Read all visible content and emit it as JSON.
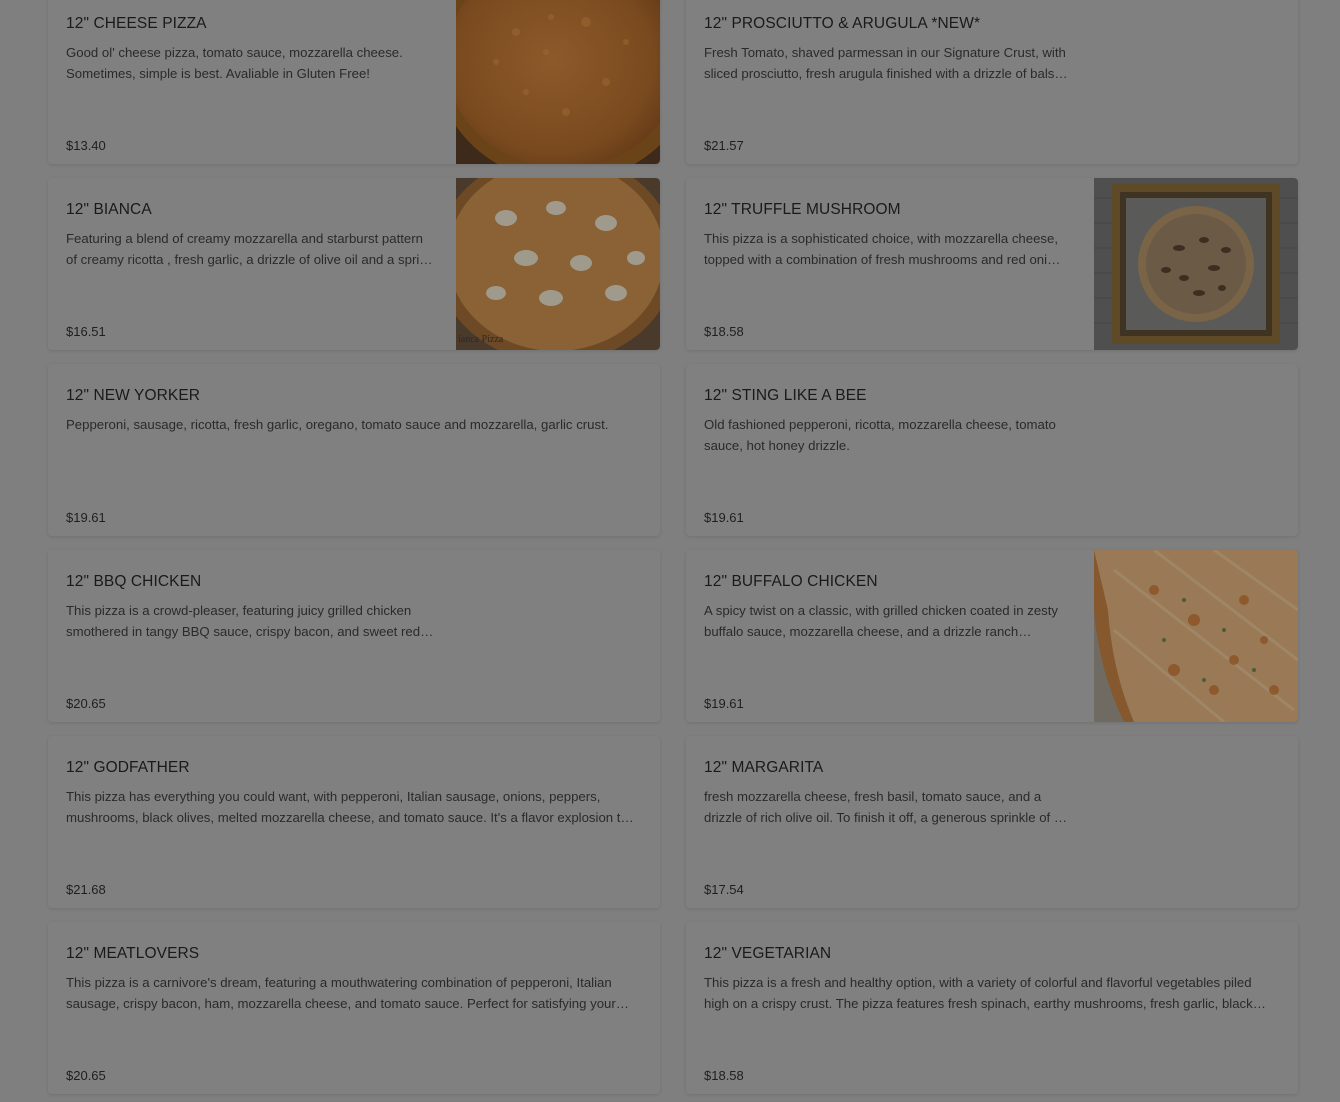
{
  "menu_items": [
    {
      "title": "12\" CHEESE PIZZA",
      "description": "Good ol' cheese pizza, tomato sauce, mozzarella cheese. Sometimes, simple is best. Avaliable in Gluten Free!",
      "price": "$13.40",
      "image": "cheese-pizza-photo"
    },
    {
      "title": "12\" PROSCIUTTO & ARUGULA *NEW*",
      "description": "Fresh Tomato, shaved parmessan in our Signature Crust, with sliced prosciutto, fresh arugula finished with a drizzle of bals…",
      "price": "$21.57",
      "image": ""
    },
    {
      "title": "12\" BIANCA",
      "description": "Featuring a blend of creamy mozzarella and starburst pattern of creamy ricotta , fresh garlic, a drizzle of olive oil and a spri…",
      "price": "$16.51",
      "image": "bianca-pizza-photo",
      "image_caption": "ianca Pizza"
    },
    {
      "title": "12\" TRUFFLE MUSHROOM",
      "description": "This pizza is a sophisticated choice, with mozzarella cheese, topped with a combination of fresh mushrooms and red oni…",
      "price": "$18.58",
      "image": "truffle-mushroom-pizza-photo"
    },
    {
      "title": "12\" NEW YORKER",
      "description": "Pepperoni, sausage, ricotta, fresh garlic, oregano, tomato sauce and mozzarella, garlic crust.",
      "price": "$19.61",
      "image": ""
    },
    {
      "title": "12\" STING LIKE A BEE",
      "description": "Old fashioned pepperoni, ricotta, mozzarella cheese, tomato sauce, hot honey drizzle.",
      "price": "$19.61",
      "image": ""
    },
    {
      "title": "12\" BBQ CHICKEN",
      "description": "This pizza is a crowd-pleaser, featuring juicy grilled chicken smothered in tangy BBQ sauce, crispy bacon, and sweet red …",
      "price": "$20.65",
      "image": ""
    },
    {
      "title": "12\" BUFFALO CHICKEN",
      "description": "A spicy twist on a classic, with grilled chicken coated in zesty buffalo sauce, mozzarella cheese, and a drizzle ranch dressing.",
      "price": "$19.61",
      "image": "buffalo-chicken-pizza-photo"
    },
    {
      "title": "12\" GODFATHER",
      "description": "This pizza has everything you could want, with pepperoni, Italian sausage, onions, peppers, mushrooms, black olives, melted mozzarella cheese, and tomato sauce. It's a flavor explosion t…",
      "price": "$21.68",
      "image": ""
    },
    {
      "title": "12\" MARGARITA",
      "description": "fresh mozzarella cheese, fresh basil, tomato sauce, and a drizzle of rich olive oil. To finish it off, a generous sprinkle of …",
      "price": "$17.54",
      "image": ""
    },
    {
      "title": "12\" MEATLOVERS",
      "description": "This pizza is a carnivore's dream, featuring a mouthwatering combination of pepperoni, Italian sausage, crispy bacon, ham, mozzarella cheese, and tomato sauce. Perfect for satisfying your cr…",
      "price": "$20.65",
      "image": ""
    },
    {
      "title": "12\" VEGETARIAN",
      "description": "This pizza is a fresh and healthy option, with a variety of colorful and flavorful vegetables piled high on a crispy crust. The pizza features fresh spinach, earthy mushrooms, fresh garlic, black ol…",
      "price": "$18.58",
      "image": ""
    }
  ],
  "colors": {
    "overlay_background": "#7f7f7f",
    "card_background": "#808080",
    "title_text": "#1a1a1a",
    "body_text": "#2a2a2a"
  }
}
